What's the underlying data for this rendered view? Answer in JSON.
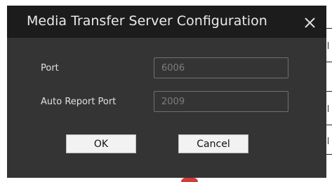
{
  "dialog": {
    "title": "Media Transfer Server Configuration",
    "close_icon": "close-icon",
    "fields": {
      "port": {
        "label": "Port",
        "value": "6006"
      },
      "auto_report_port": {
        "label": "Auto Report Port",
        "value": "2009"
      }
    },
    "buttons": {
      "ok_label": "OK",
      "cancel_label": "Cancel"
    }
  },
  "colors": {
    "titlebar": "#1c1c1c",
    "body": "#343434",
    "text": "#e0e0e0",
    "input_text": "#7d7d7d",
    "button": "#f2f2f2"
  }
}
